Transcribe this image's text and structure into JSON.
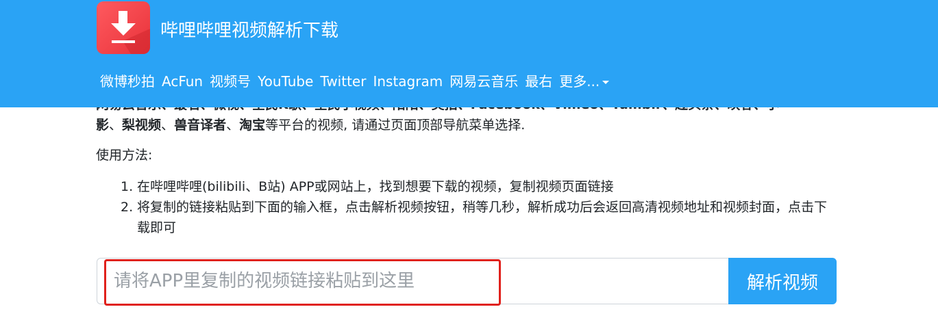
{
  "header": {
    "logo_icon": "download-icon",
    "title": "哔哩哔哩视频解析下载",
    "nav": {
      "items": [
        "微博秒拍",
        "AcFun",
        "视频号",
        "YouTube",
        "Twitter",
        "Instagram",
        "网易云音乐",
        "最右"
      ],
      "more_label": "更多..."
    },
    "background_color": "#2aa3f5"
  },
  "intro": {
    "line1_partial": "网易云音乐、最右、微视、全民K歌、全民小视频、陌陌、美拍、Facebook、Vimeo、Tumblr、趣头条、映客、小",
    "line2": {
      "p1": "影",
      "sep1": "、",
      "b1": "梨视频",
      "sep2": "、",
      "b2": "兽音译者",
      "sep3": "、",
      "b3": "淘宝",
      "tail": "等平台的视频, 请通过页面顶部导航菜单选择."
    }
  },
  "usage": {
    "label": "使用方法:",
    "steps": [
      {
        "num": "1.",
        "text": "在哔哩哔哩(bilibili、B站) APP或网站上，找到想要下载的视频，复制视频页面链接"
      },
      {
        "num": "2.",
        "text": "将复制的链接粘贴到下面的输入框，点击解析视频按钮，稍等几秒，解析成功后会返回高清视频地址和视频封面，点击下载即可"
      }
    ]
  },
  "form": {
    "placeholder": "请将APP里复制的视频链接粘贴到这里",
    "value": "",
    "button_label": "解析视频",
    "button_color": "#2aa3f5",
    "highlight_color": "#e0201b"
  }
}
